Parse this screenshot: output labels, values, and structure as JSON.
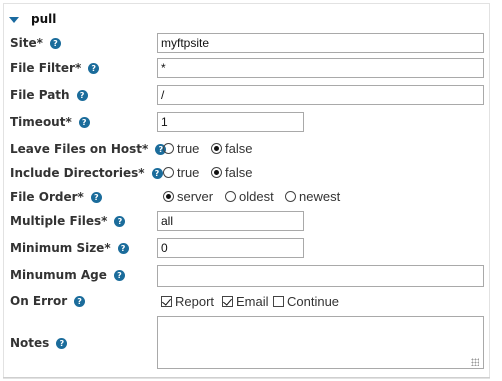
{
  "section": {
    "title": "pull"
  },
  "help_symbol": "?",
  "labels": {
    "site": "Site*",
    "file_filter": "File Filter*",
    "file_path": "File Path",
    "timeout": "Timeout*",
    "leave_files": "Leave Files on Host*",
    "include_dirs": "Include Directories*",
    "file_order": "File Order*",
    "multiple_files": "Multiple Files*",
    "minimum_size": "Minimum Size*",
    "minimum_age": "Minumum Age",
    "on_error": "On Error",
    "notes": "Notes"
  },
  "values": {
    "site": "myftpsite",
    "file_filter": "*",
    "file_path": "/",
    "timeout": "1",
    "multiple_files": "all",
    "minimum_size": "0",
    "minimum_age": "",
    "notes": ""
  },
  "options": {
    "leave_files": [
      {
        "label": "true",
        "selected": false
      },
      {
        "label": "false",
        "selected": true
      }
    ],
    "include_dirs": [
      {
        "label": "true",
        "selected": false
      },
      {
        "label": "false",
        "selected": true
      }
    ],
    "file_order": [
      {
        "label": "server",
        "selected": true
      },
      {
        "label": "oldest",
        "selected": false
      },
      {
        "label": "newest",
        "selected": false
      }
    ],
    "on_error": [
      {
        "label": "Report",
        "checked": true
      },
      {
        "label": "Email",
        "checked": true
      },
      {
        "label": "Continue",
        "checked": false
      }
    ]
  },
  "colors": {
    "accent": "#1b6c9b",
    "border": "#a9a9a9"
  }
}
